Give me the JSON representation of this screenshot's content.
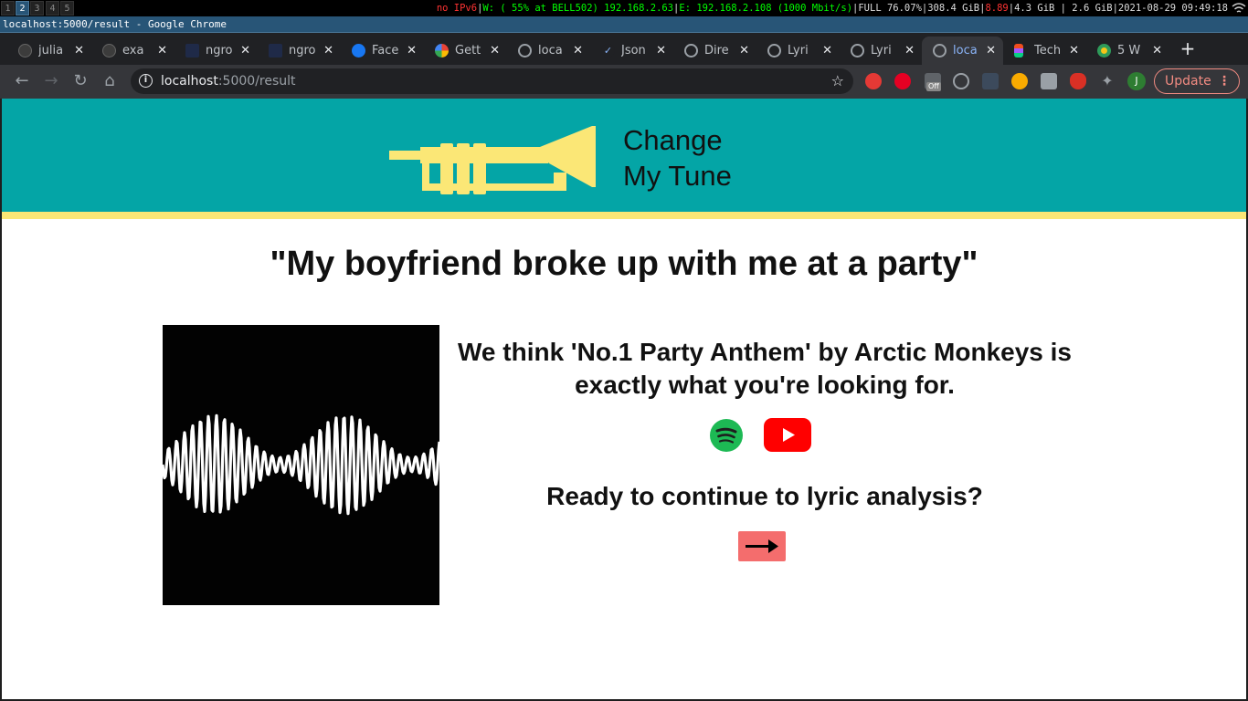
{
  "system_bar": {
    "workspaces": [
      "1",
      "2",
      "3",
      "4",
      "5"
    ],
    "active_workspace": "2",
    "status_ipv6": "no IPv6",
    "status_wifi": "W: ( 55% at BELL502) 192.168.2.63",
    "status_eth": "E: 192.168.2.108 (1000 Mbit/s)",
    "status_battery": "FULL 76.07%",
    "status_disk": "308.4 GiB",
    "status_load": "8.89",
    "status_mem": "4.3 GiB | 2.6 GiB",
    "status_datetime": "2021-08-29 09:49:18",
    "colors": {
      "red": "#ff3333",
      "green": "#00ff00"
    }
  },
  "window": {
    "title": "localhost:5000/result - Google Chrome"
  },
  "tabs": [
    {
      "title": "julia",
      "icon": "github-icon"
    },
    {
      "title": "exa",
      "icon": "github-icon"
    },
    {
      "title": "ngro",
      "icon": "ngrok-icon"
    },
    {
      "title": "ngro",
      "icon": "ngrok-icon"
    },
    {
      "title": "Face",
      "icon": "facebook-icon"
    },
    {
      "title": "Gett",
      "icon": "google-cloud-icon"
    },
    {
      "title": "loca",
      "icon": "globe-icon"
    },
    {
      "title": "Json",
      "icon": "json-icon"
    },
    {
      "title": "Dire",
      "icon": "globe-icon"
    },
    {
      "title": "Lyri",
      "icon": "globe-icon"
    },
    {
      "title": "Lyri",
      "icon": "globe-icon"
    },
    {
      "title": "loca",
      "icon": "globe-icon",
      "active": true
    },
    {
      "title": "Tech",
      "icon": "figma-icon"
    },
    {
      "title": "5 W",
      "icon": "flower-icon"
    }
  ],
  "toolbar": {
    "url_host": "localhost",
    "url_path": ":5000/result",
    "extension_badge": "Off",
    "profile_initial": "J",
    "update_label": "Update"
  },
  "page": {
    "brand_line1": "Change",
    "brand_line2": "My Tune",
    "quote": "\"My boyfriend broke up with me at a party\"",
    "recommendation": "We think 'No.1 Party Anthem' by Arctic Monkeys is exactly what you're looking for.",
    "prompt": "Ready to continue to lyric analysis?",
    "colors": {
      "banner": "#04a5a6",
      "accent_yellow": "#fbe776",
      "button_red": "#f46d6d",
      "spotify_green": "#1db954",
      "youtube_red": "#ff0000"
    }
  }
}
